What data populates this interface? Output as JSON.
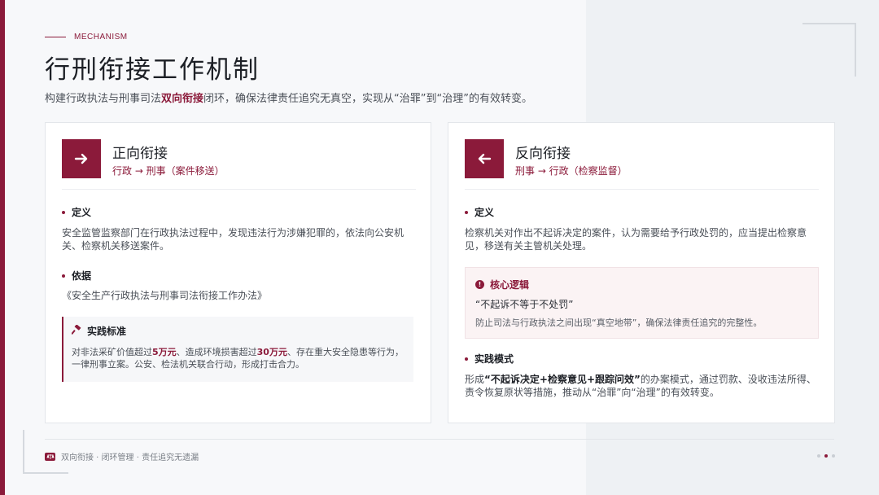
{
  "header": {
    "eyebrow": "MECHANISM",
    "title": "行刑衔接工作机制",
    "subtitle_pre": "构建行政执法与刑事司法",
    "subtitle_hl": "双向衔接",
    "subtitle_post": "闭环，确保法律责任追究无真空，实现从“治罪”到“治理”的有效转变。"
  },
  "left_card": {
    "icon": "arrow-right-icon",
    "title": "正向衔接",
    "subtitle": "行政 → 刑事（案件移送）",
    "def_label": "定义",
    "def_text": "安全监管监察部门在行政执法过程中，发现违法行为涉嫌犯罪的，依法向公安机关、检察机关移送案件。",
    "basis_label": "依据",
    "basis_text": "《安全生产行政执法与刑事司法衔接工作办法》",
    "practice": {
      "icon": "hammer-icon",
      "title": "实践标准",
      "text_1": "对非法采矿价值超过",
      "amount_1": "5万元",
      "text_2": "、造成环境损害超过",
      "amount_2": "30万元",
      "text_3": "、存在重大安全隐患等行为，一律刑事立案。公安、检法机关联合行动，形成打击合力。"
    }
  },
  "right_card": {
    "icon": "arrow-left-icon",
    "title": "反向衔接",
    "subtitle": "刑事 → 行政（检察监督）",
    "def_label": "定义",
    "def_text": "检察机关对作出不起诉决定的案件，认为需要给予行政处罚的，应当提出检察意见，移送有关主管机关处理。",
    "core": {
      "icon": "exclamation-icon",
      "title": "核心逻辑",
      "line1": "“不起诉不等于不处罚”",
      "line2": "防止司法与行政执法之间出现“真空地带”，确保法律责任追究的完整性。"
    },
    "mode_label": "实践模式",
    "mode_pre": "形成",
    "mode_bold": "“不起诉决定+检察意见+跟踪问效”",
    "mode_post": "的办案模式，通过罚款、没收违法所得、责令恢复原状等措施，推动从“治罪”向“治理”的有效转变。"
  },
  "footer": {
    "text": "双向衔接 · 闭环管理 · 责任追究无遗漏",
    "logo_icon": "scale-icon"
  },
  "pagination": {
    "total": 3,
    "active_index": 1
  },
  "colors": {
    "accent": "#8b1a3a",
    "background": "#f7f8fa",
    "card": "#ffffff"
  }
}
